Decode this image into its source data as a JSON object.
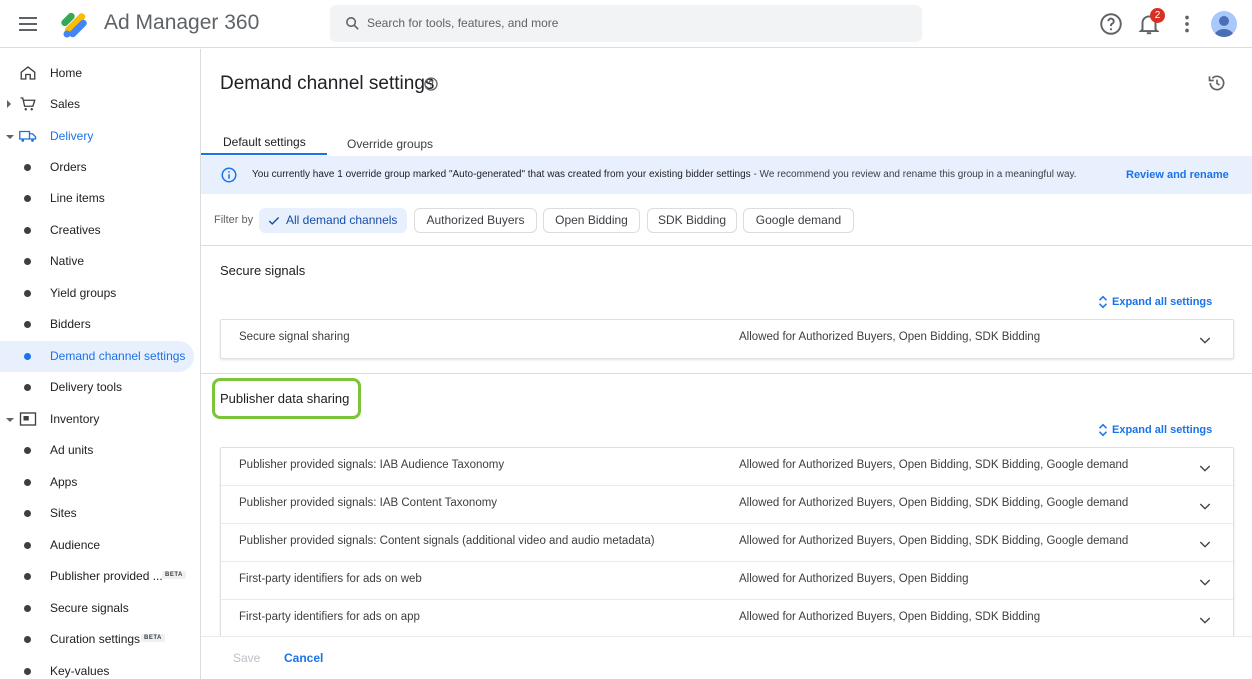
{
  "header": {
    "app_title": "Ad Manager 360",
    "search_placeholder": "Search for tools, features, and more",
    "notification_count": "2"
  },
  "sidebar": {
    "items": [
      {
        "label": "Home",
        "icon": "home-icon"
      },
      {
        "label": "Sales",
        "icon": "cart-icon"
      },
      {
        "label": "Delivery",
        "icon": "truck-icon"
      },
      {
        "label": "Orders"
      },
      {
        "label": "Line items"
      },
      {
        "label": "Creatives"
      },
      {
        "label": "Native"
      },
      {
        "label": "Yield groups"
      },
      {
        "label": "Bidders"
      },
      {
        "label": "Demand channel settings"
      },
      {
        "label": "Delivery tools"
      },
      {
        "label": "Inventory",
        "icon": "inventory-icon"
      },
      {
        "label": "Ad units"
      },
      {
        "label": "Apps"
      },
      {
        "label": "Sites"
      },
      {
        "label": "Audience"
      },
      {
        "label": "Publisher provided ..."
      },
      {
        "label": "Secure signals"
      },
      {
        "label": "Curation settings"
      },
      {
        "label": "Key-values"
      }
    ],
    "beta_label": "BETA"
  },
  "page": {
    "title": "Demand channel settings",
    "tabs": [
      {
        "label": "Default settings"
      },
      {
        "label": "Override groups"
      }
    ],
    "banner": {
      "text_bold": "You currently have 1 override group marked \"Auto-generated\" that was created from your existing bidder settings",
      "text_rest": " - We recommend you review and rename this group in a meaningful way.",
      "link": "Review and rename"
    },
    "filter": {
      "label": "Filter by",
      "chips": [
        "All demand channels",
        "Authorized Buyers",
        "Open Bidding",
        "SDK Bidding",
        "Google demand"
      ]
    },
    "expand_all_label": "Expand all settings",
    "sections": [
      {
        "title": "Secure signals",
        "rows": [
          {
            "label": "Secure signal sharing",
            "value": "Allowed for Authorized Buyers, Open Bidding, SDK Bidding"
          }
        ]
      },
      {
        "title": "Publisher data sharing",
        "rows": [
          {
            "label": "Publisher provided signals: IAB Audience Taxonomy",
            "value": "Allowed for Authorized Buyers, Open Bidding, SDK Bidding, Google demand"
          },
          {
            "label": "Publisher provided signals: IAB Content Taxonomy",
            "value": "Allowed for Authorized Buyers, Open Bidding, SDK Bidding, Google demand"
          },
          {
            "label": "Publisher provided signals: Content signals (additional video and audio metadata)",
            "value": "Allowed for Authorized Buyers, Open Bidding, SDK Bidding, Google demand"
          },
          {
            "label": "First-party identifiers for ads on web",
            "value": "Allowed for Authorized Buyers, Open Bidding"
          },
          {
            "label": "First-party identifiers for ads on app",
            "value": "Allowed for Authorized Buyers, Open Bidding, SDK Bidding"
          }
        ]
      }
    ],
    "footer": {
      "save": "Save",
      "cancel": "Cancel"
    }
  },
  "colors": {
    "accent": "#1a73e8",
    "banner_bg": "#e8f0fe",
    "highlight": "#7cc43a",
    "badge": "#d93025"
  }
}
